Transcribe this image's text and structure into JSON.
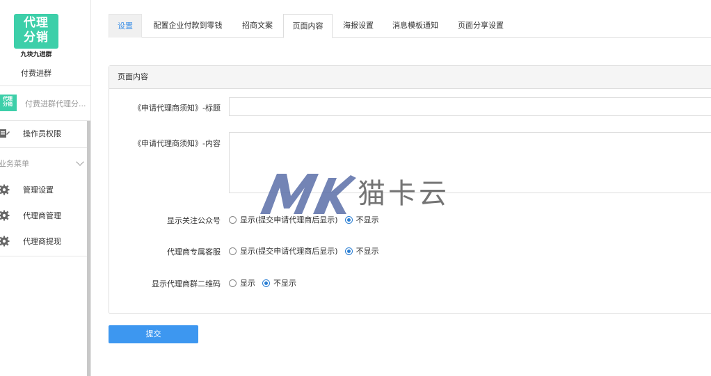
{
  "sidebar": {
    "logo_line1": "代理",
    "logo_line2": "分销",
    "logo_sub": "九块九进群",
    "brand_name": "付费进群",
    "app_entry_mini_line1": "代理",
    "app_entry_mini_line2": "分销",
    "app_entry_label": "付费进群代理分...",
    "operator_label": "操作员权限",
    "group_title": "业务菜单",
    "items": [
      {
        "label": "管理设置",
        "icon": "gear-icon"
      },
      {
        "label": "代理商管理",
        "icon": "gear-icon"
      },
      {
        "label": "代理商提现",
        "icon": "gear-icon"
      }
    ]
  },
  "tabs": [
    {
      "label": "设置"
    },
    {
      "label": "配置企业付款到零钱"
    },
    {
      "label": "招商文案"
    },
    {
      "label": "页面内容"
    },
    {
      "label": "海报设置"
    },
    {
      "label": "消息模板通知"
    },
    {
      "label": "页面分享设置"
    }
  ],
  "active_tab": "页面内容",
  "panel": {
    "title": "页面内容",
    "title_field_label": "《申请代理商须知》-标题",
    "title_field_value": "",
    "content_field_label": "《申请代理商须知》-内容",
    "content_field_value": "",
    "radios": [
      {
        "label": "显示关注公众号",
        "options": [
          "显示(提交申请代理商后显示)",
          "不显示"
        ],
        "selected": "不显示"
      },
      {
        "label": "代理商专属客服",
        "options": [
          "显示(提交申请代理商后显示)",
          "不显示"
        ],
        "selected": "不显示"
      },
      {
        "label": "显示代理商群二维码",
        "options": [
          "显示",
          "不显示"
        ],
        "selected": "不显示"
      }
    ]
  },
  "submit_label": "提交",
  "watermark": {
    "text": "猫卡云"
  },
  "colors": {
    "accent": "#3d97f0",
    "logo_green": "#3dcfa9",
    "radio_selected": "#2b7fd4"
  }
}
